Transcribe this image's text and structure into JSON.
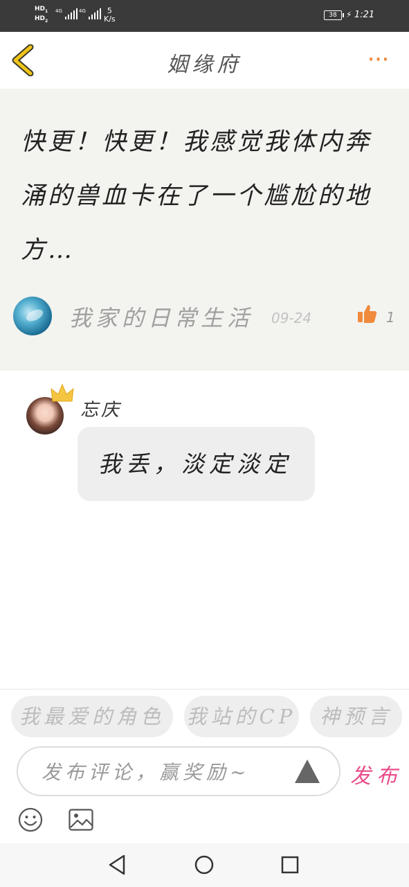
{
  "status_bar": {
    "hd1": "HD",
    "hd1_slot": "1",
    "hd2": "HD",
    "hd2_slot": "2",
    "signal1_label": "4G",
    "signal2_label": "4G",
    "speed_value": "5",
    "speed_unit": "K/s",
    "battery": "38",
    "time": "1:21"
  },
  "header": {
    "title": "姻缘府",
    "more_icon": "more-dots-icon",
    "back_icon": "chevron-left-icon",
    "back_color": "#f0c419"
  },
  "post": {
    "text": "快更！快更！我感觉我体内奔涌的兽血卡在了一个尴尬的地方…",
    "author": "我家的日常生活",
    "date": "09-24",
    "like_count": "1",
    "like_color": "#f08a3c"
  },
  "comment": {
    "name": "忘庆",
    "text": "我丢，淡定淡定",
    "crown_color": "#f5c542"
  },
  "composer": {
    "tags": [
      "我最爱的角色",
      "我站的CP",
      "神预言"
    ],
    "placeholder": "发布评论，赢奖励~",
    "publish_label": "发布",
    "publish_color": "#e94b8a"
  }
}
